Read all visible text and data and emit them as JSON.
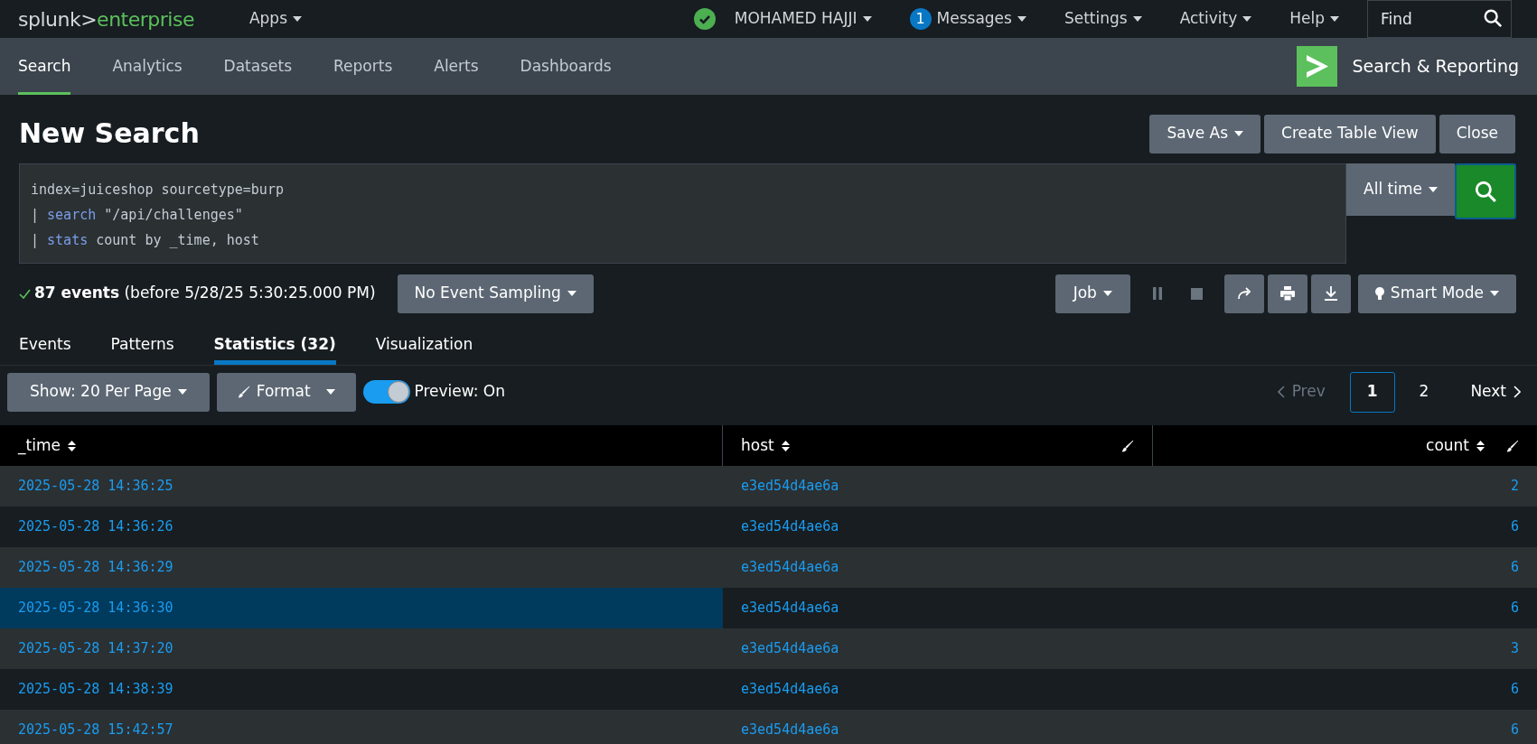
{
  "top_bar": {
    "logo": {
      "brand": "splunk>",
      "product": "enterprise"
    },
    "apps_menu": "Apps",
    "user_menu": "MOHAMED HAJJI",
    "messages": {
      "count": "1",
      "label": "Messages"
    },
    "menus": [
      "Settings",
      "Activity",
      "Help"
    ],
    "find": {
      "placeholder": "Find"
    }
  },
  "app_nav": {
    "items": [
      {
        "label": "Search",
        "selected": true
      },
      {
        "label": "Analytics",
        "selected": false
      },
      {
        "label": "Datasets",
        "selected": false
      },
      {
        "label": "Reports",
        "selected": false
      },
      {
        "label": "Alerts",
        "selected": false
      },
      {
        "label": "Dashboards",
        "selected": false
      }
    ],
    "app_title": "Search & Reporting"
  },
  "page": {
    "title": "New Search",
    "actions": [
      {
        "label": "Save As",
        "dropdown": true
      },
      {
        "label": "Create Table View",
        "dropdown": false
      },
      {
        "label": "Close",
        "dropdown": false
      }
    ]
  },
  "query": {
    "lines": [
      {
        "args": "index=juiceshop sourcetype=burp"
      },
      {
        "pipe": "|",
        "command": "search",
        "args": "\"/api/challenges\""
      },
      {
        "pipe": "|",
        "command": "stats",
        "args": "count by _time, host"
      }
    ],
    "time_range": "All time"
  },
  "status": {
    "summary": "**87 events** (before 5/28/25 5:30:25.000 PM)",
    "sampling": "No Event Sampling",
    "job": "Job",
    "mode": "Smart Mode"
  },
  "result_tabs": [
    {
      "label": "Events",
      "selected": false
    },
    {
      "label": "Patterns",
      "selected": false
    },
    {
      "label": "Statistics (32)",
      "selected": true
    },
    {
      "label": "Visualization",
      "selected": false
    }
  ],
  "toolbar": {
    "show": "Show: 20 Per Page",
    "format": "Format",
    "preview": {
      "label": "Preview: On",
      "on": true
    },
    "pagination": {
      "prev": {
        "label": "Prev",
        "disabled": true
      },
      "pages": [
        {
          "label": "1",
          "selected": true
        },
        {
          "label": "2",
          "selected": false
        }
      ],
      "next": {
        "label": "Next",
        "disabled": false
      }
    }
  },
  "table": {
    "columns": [
      {
        "label": "_time",
        "format": false
      },
      {
        "label": "host",
        "format": true
      },
      {
        "label": "count",
        "format": true
      }
    ],
    "rows": [
      {
        "cells": [
          "2025-05-28 14:36:25",
          "e3ed54d4ae6a",
          "2"
        ],
        "selected": false
      },
      {
        "cells": [
          "2025-05-28 14:36:26",
          "e3ed54d4ae6a",
          "6"
        ],
        "selected": false
      },
      {
        "cells": [
          "2025-05-28 14:36:29",
          "e3ed54d4ae6a",
          "6"
        ],
        "selected": false
      },
      {
        "cells": [
          "2025-05-28 14:36:30",
          "e3ed54d4ae6a",
          "6"
        ],
        "selected": true
      },
      {
        "cells": [
          "2025-05-28 14:37:20",
          "e3ed54d4ae6a",
          "3"
        ],
        "selected": false
      },
      {
        "cells": [
          "2025-05-28 14:38:39",
          "e3ed54d4ae6a",
          "6"
        ],
        "selected": false
      },
      {
        "cells": [
          "2025-05-28 15:42:57",
          "e3ed54d4ae6a",
          "6"
        ],
        "selected": false
      }
    ]
  }
}
